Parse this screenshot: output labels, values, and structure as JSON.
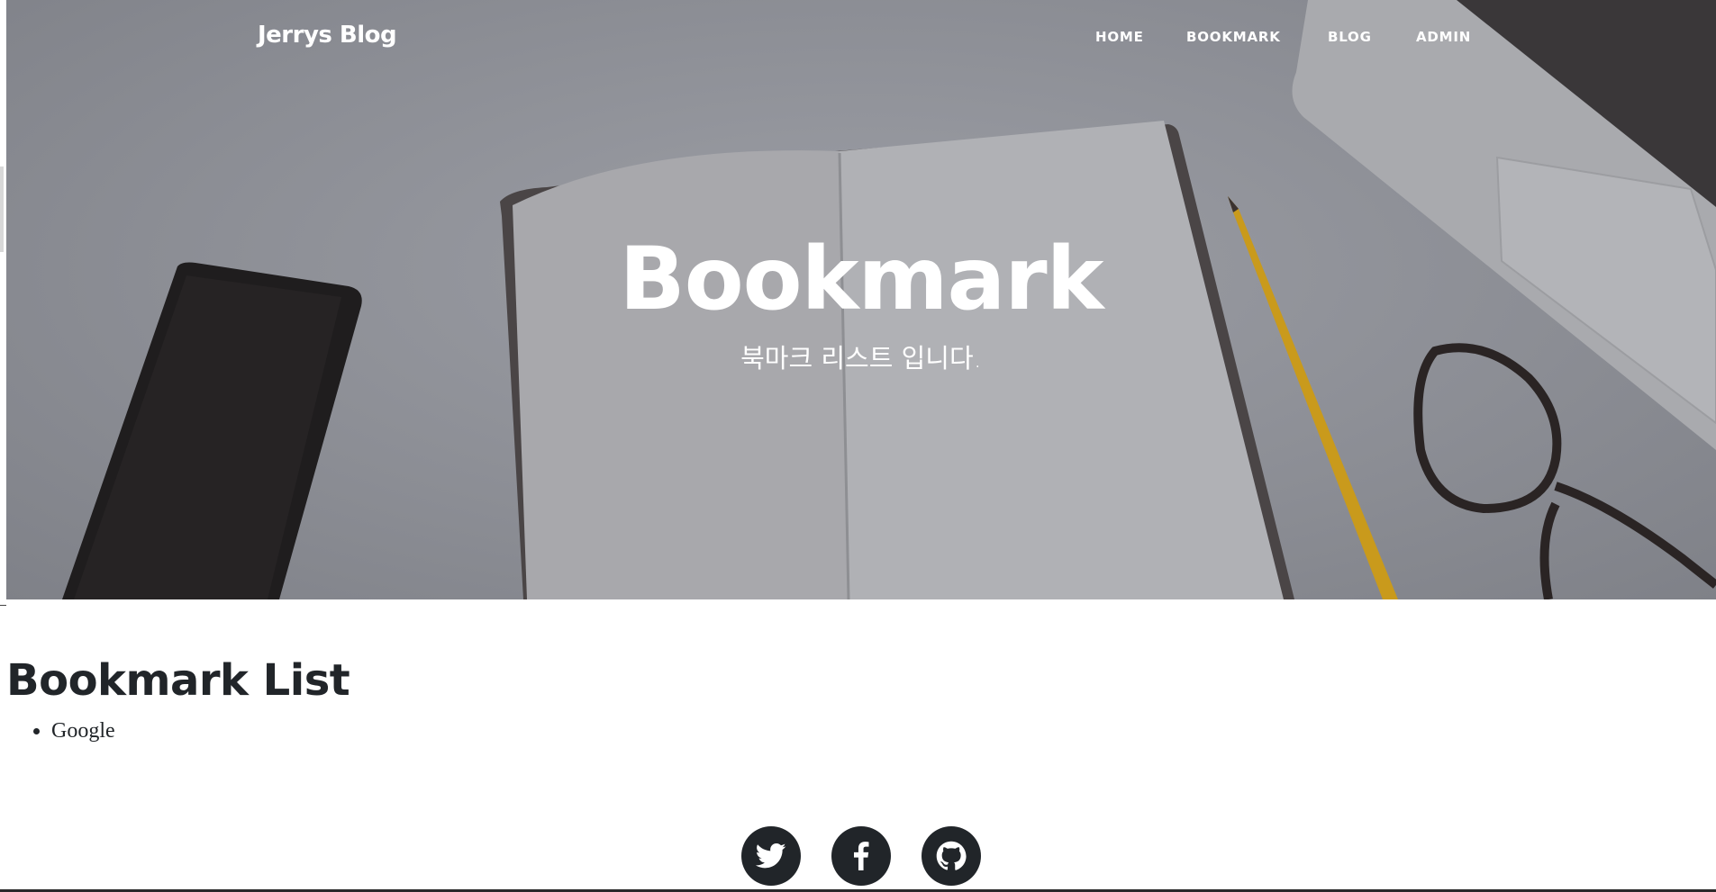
{
  "header": {
    "brand": "Jerrys Blog",
    "nav": [
      {
        "label": "HOME"
      },
      {
        "label": "BOOKMARK"
      },
      {
        "label": "BLOG"
      },
      {
        "label": "ADMIN"
      }
    ]
  },
  "hero": {
    "title": "Bookmark",
    "subtitle": "북마크 리스트 입니다."
  },
  "main": {
    "heading": "Bookmark List",
    "bookmarks": [
      {
        "label": "Google"
      }
    ]
  },
  "footer": {
    "social": [
      {
        "icon": "twitter-icon"
      },
      {
        "icon": "facebook-icon"
      },
      {
        "icon": "github-icon"
      }
    ]
  },
  "colors": {
    "hero_overlay": "#8e9097",
    "text_dark": "#212529",
    "social_bg": "#212529",
    "white": "#ffffff"
  }
}
